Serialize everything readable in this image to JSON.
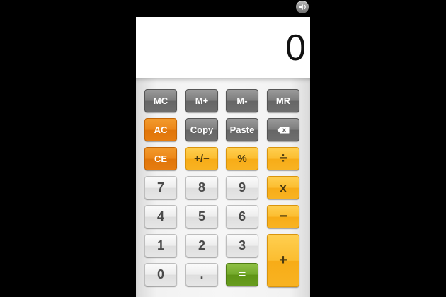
{
  "display": {
    "value": "0"
  },
  "keys": {
    "mc": "MC",
    "m_plus": "M+",
    "m_minus": "M-",
    "mr": "MR",
    "ac": "AC",
    "copy": "Copy",
    "paste": "Paste",
    "ce": "CE",
    "plus_minus": "+/−",
    "percent": "%",
    "divide": "÷",
    "seven": "7",
    "eight": "8",
    "nine": "9",
    "multiply": "x",
    "four": "4",
    "five": "5",
    "six": "6",
    "minus": "−",
    "one": "1",
    "two": "2",
    "three": "3",
    "plus": "+",
    "zero": "0",
    "decimal": ".",
    "equals": "="
  },
  "icons": {
    "sound": "speaker-icon",
    "backspace": "backspace-icon"
  },
  "colors": {
    "background": "#000000",
    "display": "#ffffff",
    "memory_keys": "#7c7c7c",
    "clear_keys": "#ec8618",
    "operator_keys": "#fbbd30",
    "digit_keys": "#ececec",
    "equals_key": "#73a92b"
  }
}
